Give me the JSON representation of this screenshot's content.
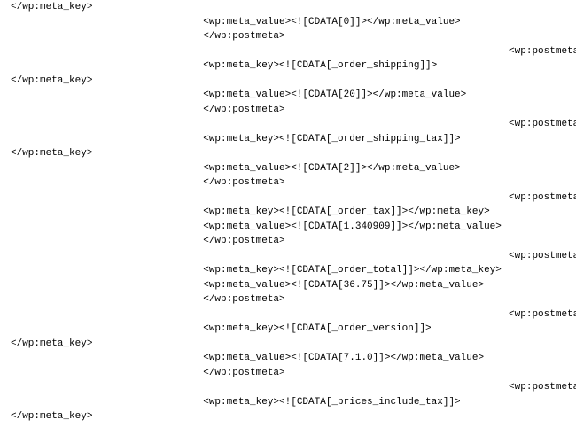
{
  "lines": [
    "</wp:meta_key>",
    "            <wp:meta_value><![CDATA[0]]></wp:meta_value>",
    "            </wp:postmeta>",
    "                                        <wp:postmeta>",
    "            <wp:meta_key><![CDATA[_order_shipping]]>",
    "</wp:meta_key>",
    "            <wp:meta_value><![CDATA[20]]></wp:meta_value>",
    "            </wp:postmeta>",
    "                                        <wp:postmeta>",
    "            <wp:meta_key><![CDATA[_order_shipping_tax]]>",
    "</wp:meta_key>",
    "            <wp:meta_value><![CDATA[2]]></wp:meta_value>",
    "            </wp:postmeta>",
    "                                        <wp:postmeta>",
    "            <wp:meta_key><![CDATA[_order_tax]]></wp:meta_key>",
    "            <wp:meta_value><![CDATA[1.340909]]></wp:meta_value>",
    "            </wp:postmeta>",
    "                                        <wp:postmeta>",
    "            <wp:meta_key><![CDATA[_order_total]]></wp:meta_key>",
    "            <wp:meta_value><![CDATA[36.75]]></wp:meta_value>",
    "            </wp:postmeta>",
    "                                        <wp:postmeta>",
    "            <wp:meta_key><![CDATA[_order_version]]>",
    "</wp:meta_key>",
    "            <wp:meta_value><![CDATA[7.1.0]]></wp:meta_value>",
    "            </wp:postmeta>",
    "                                        <wp:postmeta>",
    "            <wp:meta_key><![CDATA[_prices_include_tax]]>",
    "</wp:meta_key>"
  ]
}
